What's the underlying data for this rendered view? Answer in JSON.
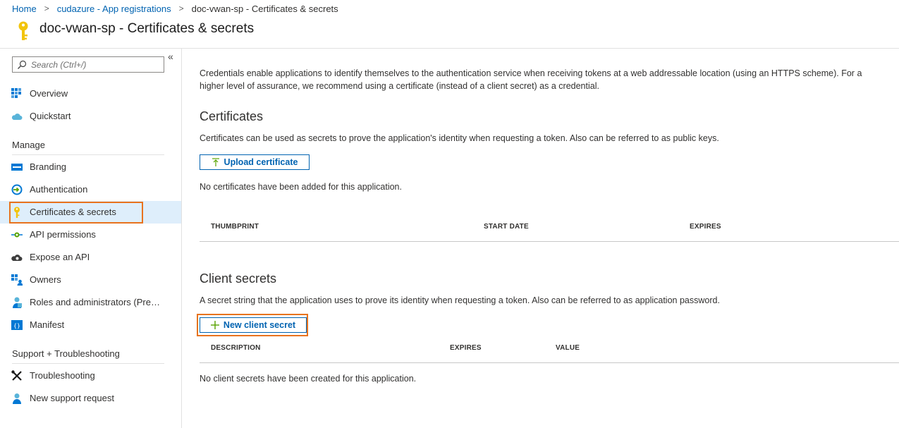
{
  "breadcrumb": {
    "items": [
      {
        "label": "Home"
      },
      {
        "label": "cudazure - App registrations"
      }
    ],
    "current": "doc-vwan-sp - Certificates & secrets"
  },
  "page": {
    "title": "doc-vwan-sp - Certificates & secrets",
    "title_icon": "key-icon"
  },
  "sidebar": {
    "collapse_glyph": "«",
    "search": {
      "placeholder": "Search (Ctrl+/)",
      "value": ""
    },
    "top_items": [
      {
        "label": "Overview",
        "icon": "grid-icon"
      },
      {
        "label": "Quickstart",
        "icon": "cloud-icon"
      }
    ],
    "manage_label": "Manage",
    "manage_items": [
      {
        "label": "Branding",
        "icon": "branding-icon"
      },
      {
        "label": "Authentication",
        "icon": "authentication-icon"
      },
      {
        "label": "Certificates & secrets",
        "icon": "key-icon",
        "active": true
      },
      {
        "label": "API permissions",
        "icon": "api-permissions-icon"
      },
      {
        "label": "Expose an API",
        "icon": "cloud-gear-icon"
      },
      {
        "label": "Owners",
        "icon": "owners-icon"
      },
      {
        "label": "Roles and administrators (Previ...",
        "icon": "user-roles-icon"
      },
      {
        "label": "Manifest",
        "icon": "manifest-icon"
      }
    ],
    "support_label": "Support + Troubleshooting",
    "support_items": [
      {
        "label": "Troubleshooting",
        "icon": "wrench-icon"
      },
      {
        "label": "New support request",
        "icon": "support-person-icon"
      }
    ]
  },
  "content": {
    "intro": "Credentials enable applications to identify themselves to the authentication service when receiving tokens at a web addressable location (using an HTTPS scheme). For a higher level of assurance, we recommend using a certificate (instead of a client secret) as a credential.",
    "certificates": {
      "heading": "Certificates",
      "description": "Certificates can be used as secrets to prove the application's identity when requesting a token. Also can be referred to as public keys.",
      "upload_label": "Upload certificate",
      "empty_text": "No certificates have been added for this application.",
      "columns": [
        "THUMBPRINT",
        "START DATE",
        "EXPIRES"
      ]
    },
    "client_secrets": {
      "heading": "Client secrets",
      "description": "A secret string that the application uses to prove its identity when requesting a token. Also can be referred to as application password.",
      "new_label": "New client secret",
      "columns": [
        "DESCRIPTION",
        "EXPIRES",
        "VALUE"
      ],
      "empty_text": "No client secrets have been created for this application."
    }
  },
  "colors": {
    "link": "#0063b1",
    "highlight": "#e8731e",
    "active_bg": "#deeefb",
    "key_yellow": "#f2c40c"
  }
}
